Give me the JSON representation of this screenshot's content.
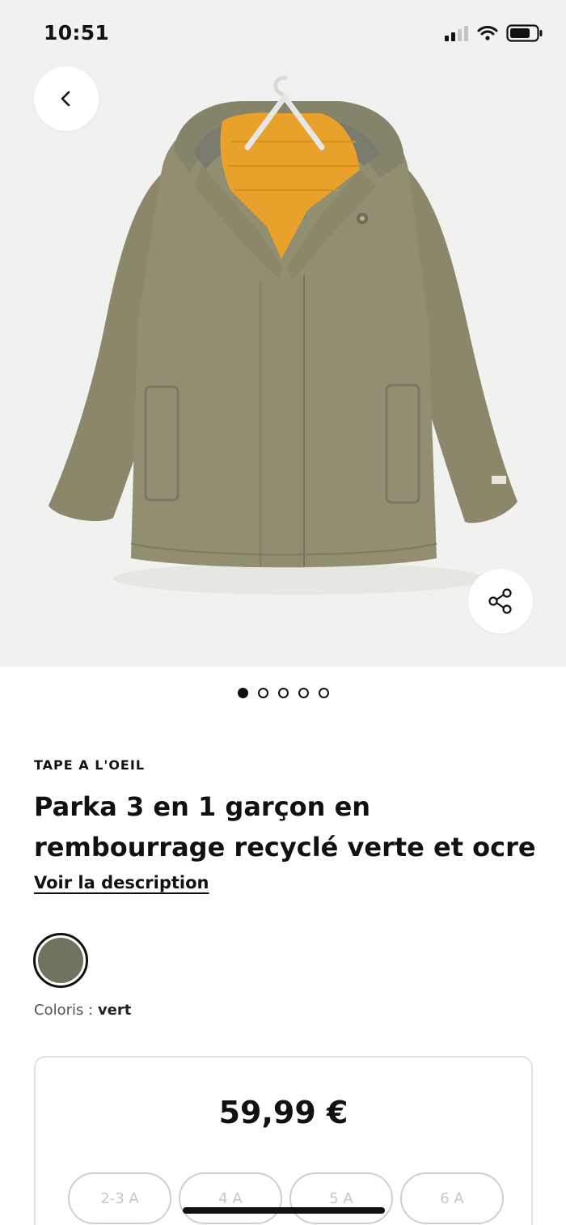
{
  "status_bar": {
    "time": "10:51",
    "icons": [
      "cellular-signal-icon",
      "wifi-icon",
      "battery-icon"
    ]
  },
  "product": {
    "image_description_icon": "parka-product-image",
    "brand": "TAPE A L'OEIL",
    "title": "Parka 3 en 1 garçon en rembourrage recyclé verte et ocre",
    "description_link": "Voir la description",
    "color_label": "Coloris :",
    "color_value": "vert",
    "color_hex": "#71735f",
    "price": "59,99 €",
    "sizes": [
      "2-3 A",
      "4 A",
      "5 A",
      "6 A"
    ]
  },
  "carousel": {
    "total": 5,
    "active_index": 0
  },
  "colors": {
    "hero_bg": "#f1f1ef",
    "parka_olive": "#8c8a6e",
    "lining_ochre": "#e8a22c"
  }
}
